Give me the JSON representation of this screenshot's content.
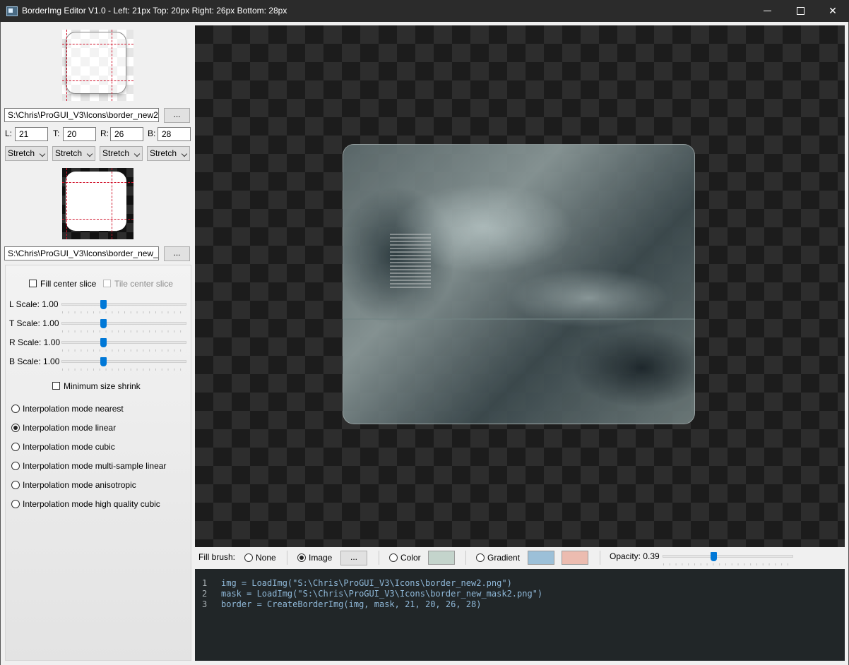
{
  "window": {
    "title": "BorderImg Editor V1.0  -  Left: 21px  Top: 20px  Right: 26px  Bottom: 28px",
    "controls": [
      "minimize",
      "maximize",
      "close"
    ]
  },
  "image_panel": {
    "image_path": "S:\\Chris\\ProGUI_V3\\Icons\\border_new2.png",
    "mask_path": "S:\\Chris\\ProGUI_V3\\Icons\\border_new_mask2.png",
    "browse_label": "...",
    "margins": [
      {
        "label": "L:",
        "value": "21"
      },
      {
        "label": "T:",
        "value": "20"
      },
      {
        "label": "R:",
        "value": "26"
      },
      {
        "label": "B:",
        "value": "28"
      }
    ],
    "modes": [
      "Stretch",
      "Stretch",
      "Stretch",
      "Stretch"
    ]
  },
  "options": {
    "fill_center_slice": {
      "label": "Fill center slice",
      "checked": false
    },
    "tile_center_slice": {
      "label": "Tile center slice",
      "checked": false,
      "enabled": false
    },
    "scales": [
      {
        "label": "L Scale: 1.00",
        "value": 1.0
      },
      {
        "label": "T Scale: 1.00",
        "value": 1.0
      },
      {
        "label": "R Scale: 1.00",
        "value": 1.0
      },
      {
        "label": "B Scale: 1.00",
        "value": 1.0
      }
    ],
    "scale_slider_fraction": 0.34,
    "minimum_size_shrink": {
      "label": "Minimum size shrink",
      "checked": false
    },
    "interpolation_modes": [
      {
        "label": "Interpolation mode nearest",
        "selected": false
      },
      {
        "label": "Interpolation mode linear",
        "selected": true
      },
      {
        "label": "Interpolation mode cubic",
        "selected": false
      },
      {
        "label": "Interpolation mode multi-sample linear",
        "selected": false
      },
      {
        "label": "Interpolation mode anisotropic",
        "selected": false
      },
      {
        "label": "Interpolation mode high quality cubic",
        "selected": false
      }
    ]
  },
  "fill_brush": {
    "label": "Fill brush:",
    "none_label": "None",
    "image_label": "Image",
    "image_browse": "...",
    "color_label": "Color",
    "gradient_label": "Gradient",
    "selected": "Image",
    "color_swatch": "#c4d4cc",
    "gradient_start": "#9cc0d8",
    "gradient_end": "#ecbcb0",
    "opacity_label": "Opacity: 0.39",
    "opacity": 0.39
  },
  "code": {
    "lines": [
      {
        "num": "1",
        "text": "img = LoadImg(\"S:\\Chris\\ProGUI_V3\\Icons\\border_new2.png\")"
      },
      {
        "num": "2",
        "text": "mask = LoadImg(\"S:\\Chris\\ProGUI_V3\\Icons\\border_new_mask2.png\")"
      },
      {
        "num": "3",
        "text": "border = CreateBorderImg(img, mask, 21, 20, 26, 28)"
      }
    ]
  },
  "colors": {
    "accent": "#0078d7",
    "guide": "#d0122a",
    "code_bg": "#212628",
    "code_text": "#8fb8d8"
  }
}
